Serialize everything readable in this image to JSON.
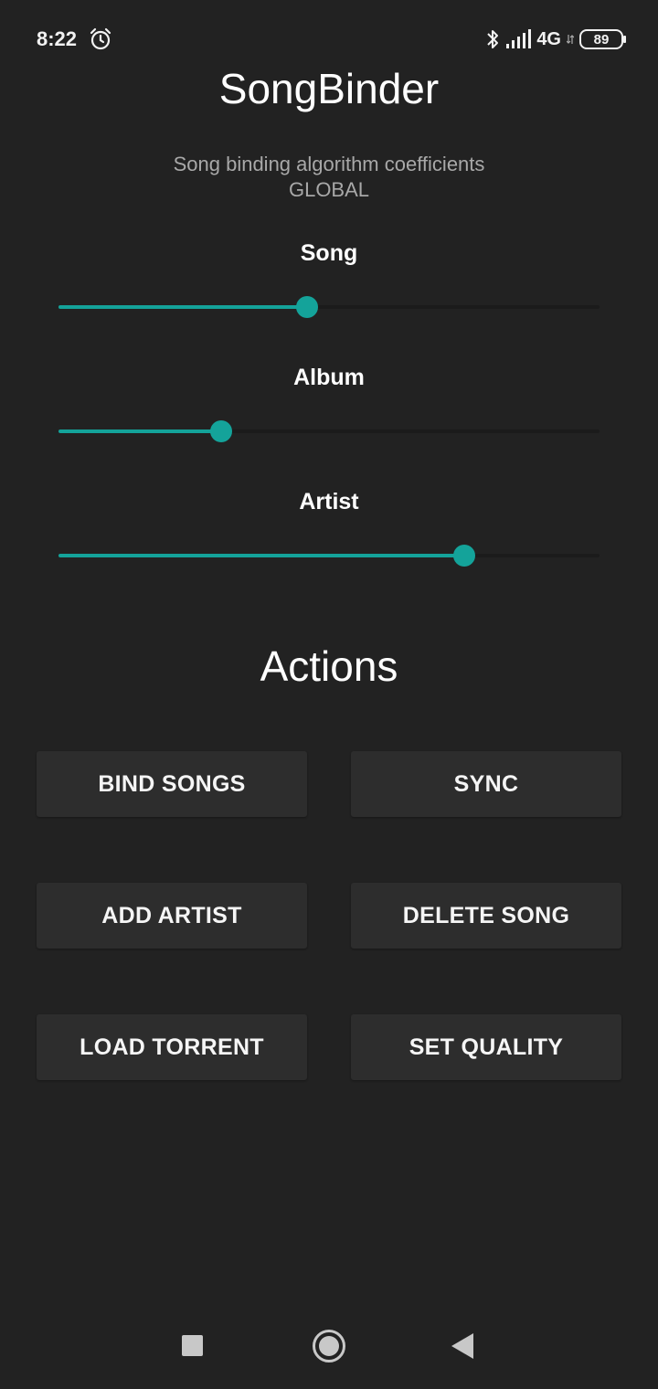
{
  "status_bar": {
    "time": "8:22",
    "alarm_icon": "alarm-clock-icon",
    "bluetooth_icon": "bluetooth-icon",
    "signal_icon": "cellular-signal-icon",
    "network": "4G",
    "battery": "89"
  },
  "header": {
    "title": "SongBinder",
    "subtitle_line1": "Song binding algorithm coefficients",
    "subtitle_line2": "GLOBAL"
  },
  "sliders": [
    {
      "label": "Song",
      "value": 0.46
    },
    {
      "label": "Album",
      "value": 0.3
    },
    {
      "label": "Artist",
      "value": 0.75
    }
  ],
  "actions": {
    "title": "Actions",
    "buttons": [
      {
        "label": "BIND SONGS"
      },
      {
        "label": "SYNC"
      },
      {
        "label": "ADD ARTIST"
      },
      {
        "label": "DELETE SONG"
      },
      {
        "label": "LOAD TORRENT"
      },
      {
        "label": "SET QUALITY"
      }
    ]
  },
  "navbar": {
    "recents_icon": "recents-square-icon",
    "home_icon": "home-circle-icon",
    "back_icon": "back-triangle-icon"
  },
  "colors": {
    "background": "#222222",
    "accent": "#14a39a",
    "button": "#2d2d2d"
  }
}
